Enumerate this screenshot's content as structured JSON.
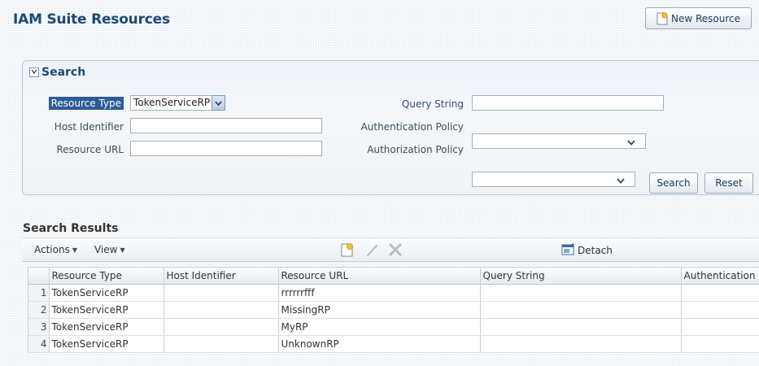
{
  "page": {
    "title": "IAM Suite Resources"
  },
  "header": {
    "new_resource_label": "New Resource"
  },
  "search": {
    "title": "Search",
    "fields": {
      "resource_type_label": "Resource Type",
      "resource_type_value": "TokenServiceRP",
      "host_identifier_label": "Host Identifier",
      "host_identifier_value": "",
      "resource_url_label": "Resource URL",
      "resource_url_value": "",
      "query_string_label": "Query String",
      "query_string_value": "",
      "authentication_policy_label": "Authentication Policy",
      "authentication_policy_value": "",
      "authorization_policy_label": "Authorization Policy",
      "authorization_policy_value": ""
    },
    "search_button": "Search",
    "reset_button": "Reset"
  },
  "results": {
    "title": "Search Results",
    "toolbar": {
      "actions_label": "Actions",
      "view_label": "View",
      "detach_label": "Detach"
    },
    "columns": [
      "Resource Type",
      "Host Identifier",
      "Resource URL",
      "Query String",
      "Authentication"
    ],
    "rows": [
      {
        "num": "1",
        "resource_type": "TokenServiceRP",
        "host_identifier": "",
        "resource_url": "rrrrrrfff",
        "query_string": "",
        "authentication": ""
      },
      {
        "num": "2",
        "resource_type": "TokenServiceRP",
        "host_identifier": "",
        "resource_url": "MissingRP",
        "query_string": "",
        "authentication": ""
      },
      {
        "num": "3",
        "resource_type": "TokenServiceRP",
        "host_identifier": "",
        "resource_url": "MyRP",
        "query_string": "",
        "authentication": ""
      },
      {
        "num": "4",
        "resource_type": "TokenServiceRP",
        "host_identifier": "",
        "resource_url": "UnknownRP",
        "query_string": "",
        "authentication": ""
      }
    ]
  },
  "icons": {
    "new_resource": "new-document-icon",
    "collapse": "collapse-icon",
    "create_row": "new-document-icon",
    "edit_row": "pencil-icon",
    "delete_row": "delete-x-icon",
    "detach": "detach-icon"
  },
  "colors": {
    "title": "#1d4a73",
    "selected_label": "#2e5c96"
  }
}
